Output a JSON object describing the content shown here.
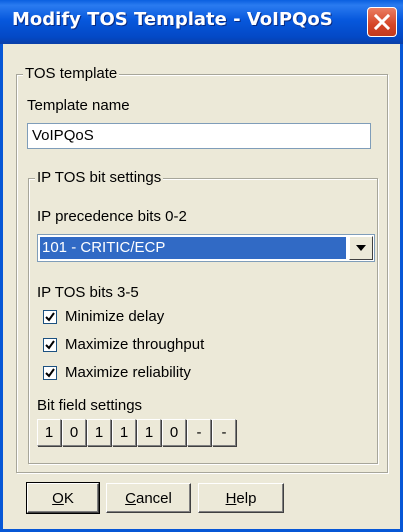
{
  "window": {
    "title": "Modify TOS Template - VoIPQoS"
  },
  "tos_group": {
    "label": "TOS template",
    "template_name_label": "Template name",
    "template_name_value": "VoIPQoS"
  },
  "bit_group": {
    "label": "IP TOS bit settings",
    "precedence_label": "IP precedence bits 0-2",
    "precedence_value": "101 - CRITIC/ECP",
    "tos_bits_label": "IP TOS bits 3-5",
    "checkboxes": [
      {
        "label": "Minimize delay",
        "checked": true
      },
      {
        "label": "Maximize throughput",
        "checked": true
      },
      {
        "label": "Maximize reliability",
        "checked": true
      }
    ],
    "bit_field_label": "Bit field settings",
    "bits": [
      "1",
      "0",
      "1",
      "1",
      "1",
      "0",
      "-",
      "-"
    ]
  },
  "buttons": {
    "ok_mnemonic": "O",
    "ok_rest": "K",
    "cancel_mnemonic": "C",
    "cancel_rest": "ancel",
    "help_mnemonic": "H",
    "help_rest": "elp"
  },
  "colors": {
    "titlebar": "#0758dd",
    "selection": "#316ac5",
    "close_button": "#d54528",
    "dialog_bg": "#ece9d8"
  },
  "icons": {
    "close": "close-icon",
    "dropdown": "chevron-down-icon",
    "check": "checkmark-icon"
  }
}
